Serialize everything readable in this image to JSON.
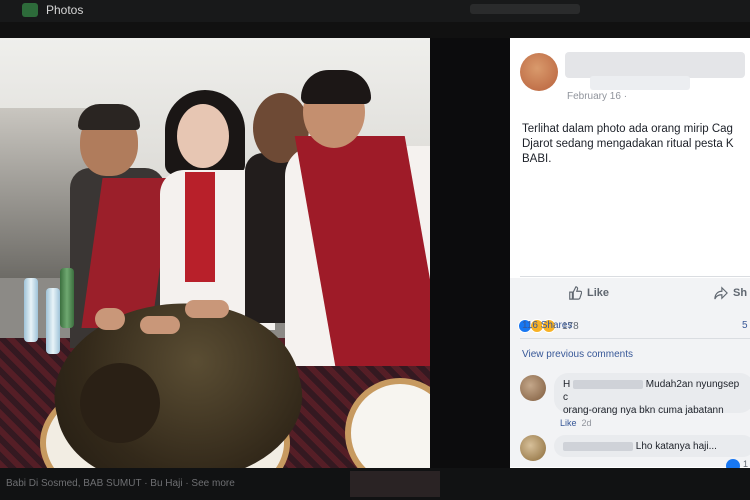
{
  "topbar": {
    "app_title": "Photos"
  },
  "post": {
    "date": "February 16 ·",
    "text": "Terlihat dalam photo ada orang mirip Cag\nDjarot sedang mengadakan ritual pesta K\nBABI.",
    "actions": {
      "like": "Like",
      "share": "Sh"
    },
    "reactions_count": "178",
    "shares": "116 Shares",
    "shares_right": "5"
  },
  "comments": {
    "view_previous": "View previous comments",
    "items": [
      {
        "prefix": "H",
        "text_line1": "Mudah2an nyungsep c",
        "text_line2": "orang-orang nya bkn cuma jabatann",
        "like_label": "Like",
        "time": "2d"
      },
      {
        "text_line1": "Lho katanya haji...",
        "reply_count": "1"
      }
    ]
  },
  "bottom_caption": "Babi Di Sosmed, BAB SUMUT · Bu Haji · See more"
}
